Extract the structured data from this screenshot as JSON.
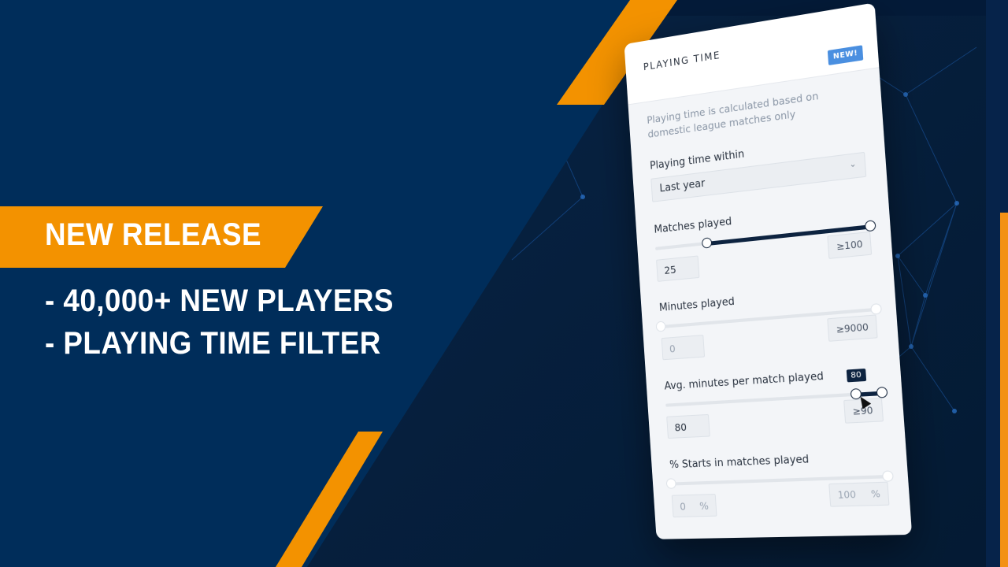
{
  "promo": {
    "banner_title": "NEW RELEASE",
    "features": [
      "- 40,000+ NEW PLAYERS",
      "- PLAYING TIME FILTER"
    ]
  },
  "colors": {
    "brand_navy": "#002d5a",
    "accent_orange": "#f39200",
    "badge_blue": "#4a8fe0",
    "slider_fill": "#0d2340"
  },
  "panel": {
    "title": "PLAYING TIME",
    "badge": "NEW!",
    "note": "Playing time is calculated based on domestic league matches only",
    "period": {
      "label": "Playing time within",
      "selected": "Last year",
      "icon": "chevron-down-icon"
    },
    "sliders": [
      {
        "label": "Matches played",
        "min_value": "25",
        "max_value": "≥100",
        "range": [
          0,
          100
        ],
        "selected": [
          25,
          100
        ],
        "active": true
      },
      {
        "label": "Minutes played",
        "min_value": "0",
        "max_value": "≥9000",
        "range": [
          0,
          9000
        ],
        "selected": [
          0,
          9000
        ],
        "active": false
      },
      {
        "label": "Avg. minutes per match played",
        "min_value": "80",
        "max_value": "≥90",
        "range": [
          0,
          90
        ],
        "selected": [
          80,
          90
        ],
        "active": true,
        "tooltip": "80"
      },
      {
        "label": "% Starts in matches played",
        "min_value": "0",
        "max_value": "100",
        "unit": "%",
        "range": [
          0,
          100
        ],
        "selected": [
          0,
          100
        ],
        "active": false
      }
    ]
  }
}
